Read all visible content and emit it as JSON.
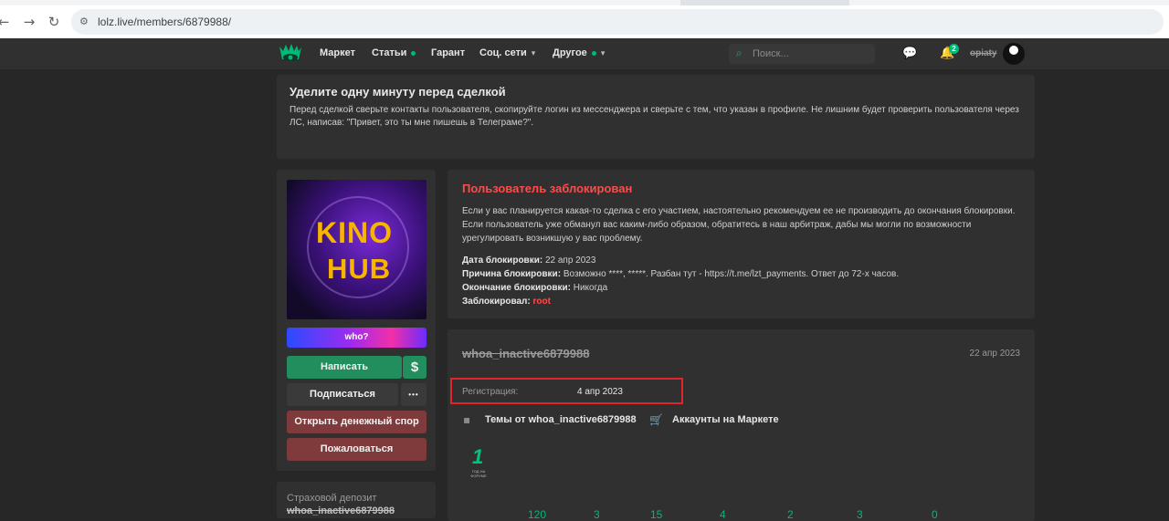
{
  "browser": {
    "url": "lolz.live/members/6879988/",
    "back_icon": "arrow-left",
    "forward_icon": "arrow-right",
    "reload_icon": "reload",
    "site_info_icon": "tune"
  },
  "header": {
    "nav": [
      {
        "label": "Маркет",
        "dot": false,
        "chevron": false
      },
      {
        "label": "Статьи",
        "dot": true,
        "chevron": false
      },
      {
        "label": "Гарант",
        "dot": false,
        "chevron": false
      },
      {
        "label": "Соц. сети",
        "dot": false,
        "chevron": true
      },
      {
        "label": "Другое",
        "dot": true,
        "chevron": true
      }
    ],
    "search_placeholder": "Поиск...",
    "notifications_count": "2",
    "username": "opiaty",
    "accent": "#00ba78"
  },
  "notice": {
    "title": "Уделите одну минуту перед сделкой",
    "text": "Перед сделкой сверьте контакты пользователя, скопируйте логин из мессенджера и сверьте с тем, что указан в профиле. Не лишним будет проверить пользователя через ЛС, написав: \"Привет, это ты мне пишешь в Телеграме?\"."
  },
  "sidebar": {
    "avatar_text_top": "KINO",
    "avatar_text_bottom": "HUB",
    "banner_label": "who?",
    "write_button": "Написать",
    "money_button": "$",
    "subscribe_button": "Подписаться",
    "more_button": "•••",
    "dispute_button": "Открыть денежный спор",
    "report_button": "Пожаловаться",
    "deposit_label": "Страховой депозит",
    "deposit_user": "whoa_inactive6879988"
  },
  "ban": {
    "title": "Пользователь заблокирован",
    "text": "Если у вас планируется какая-то сделка с его участием, настоятельно рекомендуем ее не производить до окончания блокировки. Если пользователь уже обманул вас каким-либо образом, обратитесь в наш арбитраж, дабы мы могли по возможности урегулировать возникшую у вас проблему.",
    "date_label": "Дата блокировки:",
    "date_value": "22 апр 2023",
    "reason_label": "Причина блокировки:",
    "reason_value": "Возможно ****, *****. Разбан тут - https://t.me/lzt_payments. Ответ до 72-х часов.",
    "end_label": "Окончание блокировки:",
    "end_value": "Никогда",
    "by_label": "Заблокировал:",
    "by_value": "root",
    "title_color": "#ff4b4b"
  },
  "profile": {
    "name": "whoa_inactive6879988",
    "date": "22 апр 2023",
    "reg_label": "Регистрация:",
    "reg_value": "4 апр 2023",
    "topics_link": "Темы от whoa_inactive6879988",
    "market_link": "Аккаунты на Маркете",
    "trophy_number": "1",
    "trophy_caption": "ГОД НА ФОРУМЕ",
    "stats": [
      "120",
      "3",
      "15",
      "4",
      "2",
      "3",
      "0"
    ]
  }
}
